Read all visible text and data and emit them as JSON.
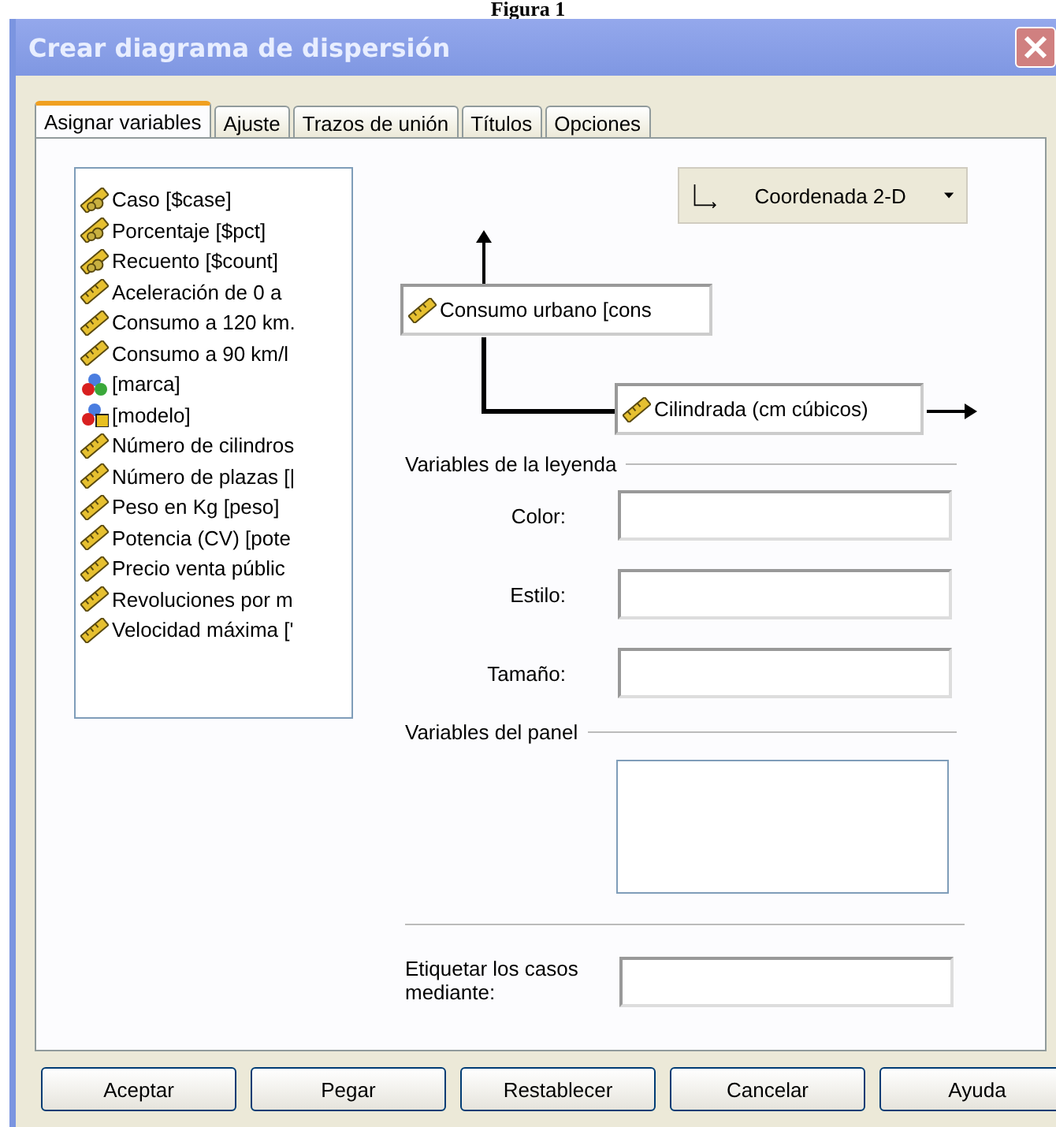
{
  "caption": "Figura 1",
  "window": {
    "title": "Crear diagrama de dispersión"
  },
  "tabs": [
    {
      "label": "Asignar variables",
      "selected": true
    },
    {
      "label": "Ajuste",
      "selected": false
    },
    {
      "label": "Trazos de unión",
      "selected": false
    },
    {
      "label": "Títulos",
      "selected": false
    },
    {
      "label": "Opciones",
      "selected": false
    }
  ],
  "variables": [
    {
      "kind": "system",
      "label": "Caso [$case]"
    },
    {
      "kind": "system",
      "label": "Porcentaje [$pct]"
    },
    {
      "kind": "system",
      "label": "Recuento [$count]"
    },
    {
      "kind": "scale",
      "label": "Aceleración de 0 a"
    },
    {
      "kind": "scale",
      "label": "Consumo a 120 km."
    },
    {
      "kind": "scale",
      "label": "Consumo a 90 km/l"
    },
    {
      "kind": "nominal",
      "label": "[marca]"
    },
    {
      "kind": "string",
      "label": "[modelo]"
    },
    {
      "kind": "scale",
      "label": "Número de cilindros"
    },
    {
      "kind": "scale",
      "label": "Número de plazas [|"
    },
    {
      "kind": "scale",
      "label": "Peso en Kg [peso]"
    },
    {
      "kind": "scale",
      "label": "Potencia (CV) [pote"
    },
    {
      "kind": "scale",
      "label": "Precio venta públic"
    },
    {
      "kind": "scale",
      "label": "Revoluciones por m"
    },
    {
      "kind": "scale",
      "label": "Velocidad máxima ['"
    }
  ],
  "coordinate_button": {
    "label": "Coordenada 2-D"
  },
  "y_axis": {
    "variable": "Consumo urbano [cons"
  },
  "x_axis": {
    "variable": "Cilindrada (cm cúbicos)"
  },
  "legend": {
    "title": "Variables de la leyenda",
    "fields": [
      {
        "label": "Color:"
      },
      {
        "label": "Estilo:"
      },
      {
        "label": "Tamaño:"
      }
    ]
  },
  "panel": {
    "title": "Variables del panel"
  },
  "label_cases": {
    "label": "Etiquetar los casos mediante:"
  },
  "buttons": [
    "Aceptar",
    "Pegar",
    "Restablecer",
    "Cancelar",
    "Ayuda"
  ]
}
